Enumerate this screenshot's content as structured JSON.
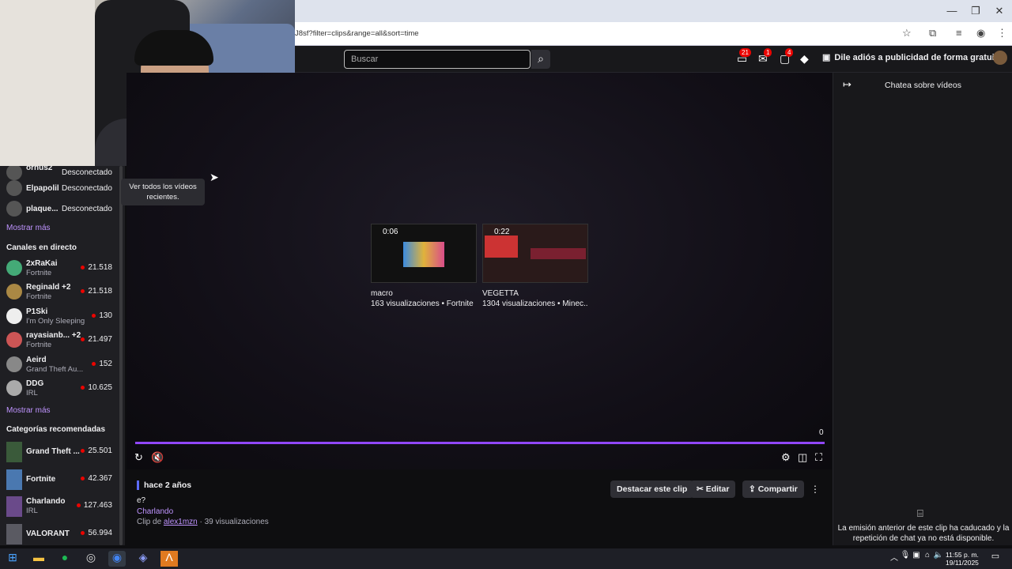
{
  "browser": {
    "url_fragment": "J8sf?filter=clips&range=all&sort=time"
  },
  "nav": {
    "search_placeholder": "Buscar",
    "badges": [
      "21",
      "1",
      "4"
    ],
    "promo": "Dile adiós a publicidad de forma gratuita"
  },
  "sidebar": {
    "followed_offline": [
      {
        "name": "ornus2",
        "status": "Desconectado"
      },
      {
        "name": "Elpapolil",
        "status": "Desconectado"
      },
      {
        "name": "plaque...",
        "status": "Desconectado"
      }
    ],
    "show_more_1": "Mostrar más",
    "live_header": "Canales en directo",
    "live": [
      {
        "name": "2xRaKai",
        "game": "Fortnite",
        "viewers": "21.518"
      },
      {
        "name": "Reginald +2",
        "game": "Fortnite",
        "viewers": "21.518"
      },
      {
        "name": "P1Ski",
        "game": "I'm Only Sleeping",
        "viewers": "130"
      },
      {
        "name": "rayasianb... +2",
        "game": "Fortnite",
        "viewers": "21.497"
      },
      {
        "name": "Aeird",
        "game": "Grand Theft Au...",
        "viewers": "152"
      },
      {
        "name": "DDG",
        "game": "IRL",
        "viewers": "10.625"
      }
    ],
    "show_more_2": "Mostrar más",
    "cat_header": "Categorías recomendadas",
    "categories": [
      {
        "name": "Grand Theft ...",
        "sub": "",
        "viewers": "25.501"
      },
      {
        "name": "Fortnite",
        "sub": "",
        "viewers": "42.367"
      },
      {
        "name": "Charlando",
        "sub": "IRL",
        "viewers": "127.463"
      },
      {
        "name": "VALORANT",
        "sub": "",
        "viewers": "56.994"
      }
    ]
  },
  "tooltip": "Ver todos los vídeos recientes.",
  "clips": [
    {
      "duration": "0:06",
      "title": "macro",
      "meta": "163 visualizaciones • Fortnite"
    },
    {
      "duration": "0:22",
      "title": "VEGETTA",
      "meta": "1304 visualizaciones • Minec..."
    }
  ],
  "player": {
    "count": "0"
  },
  "info": {
    "ago": "hace 2 años",
    "title": "e?",
    "category": "Charlando",
    "by_prefix": "Clip de",
    "author": "alex1mzn",
    "views": "· 39 visualizaciones",
    "feature_btn": "Destacar este clip",
    "edit_btn": "Editar",
    "share_btn": "Compartir"
  },
  "chat": {
    "header": "Chatea sobre vídeos",
    "unavailable": "La emisión anterior de este clip ha caducado y la repetición de chat ya no está disponible."
  },
  "taskbar": {
    "time": "11:55 p. m.",
    "date": "19/11/2025"
  }
}
